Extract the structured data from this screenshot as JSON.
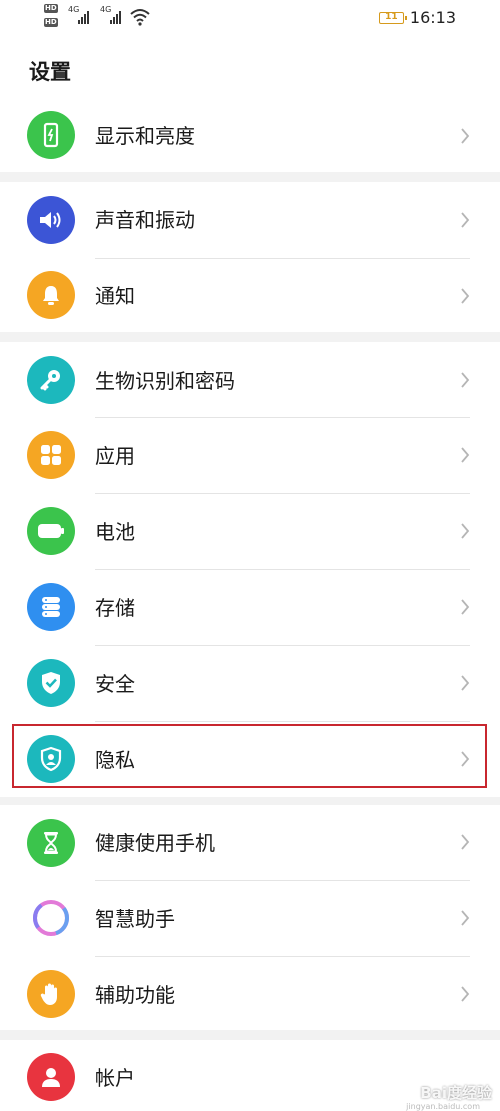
{
  "status_bar": {
    "hd1": "HD",
    "hd2": "HD",
    "net1": "4G",
    "net2": "4G",
    "battery_level": "11",
    "time": "16:13"
  },
  "header": {
    "title": "设置"
  },
  "items": [
    {
      "label": "显示和亮度",
      "icon": "display-brightness-icon",
      "color": "#3bc44c"
    },
    {
      "label": "声音和振动",
      "icon": "speaker-icon",
      "color": "#3c55d6"
    },
    {
      "label": "通知",
      "icon": "bell-icon",
      "color": "#f5a623"
    },
    {
      "label": "生物识别和密码",
      "icon": "key-icon",
      "color": "#1cb8bd"
    },
    {
      "label": "应用",
      "icon": "apps-grid-icon",
      "color": "#f5a623"
    },
    {
      "label": "电池",
      "icon": "battery-icon",
      "color": "#3bc44c"
    },
    {
      "label": "存储",
      "icon": "storage-icon",
      "color": "#2f8ff0"
    },
    {
      "label": "安全",
      "icon": "shield-check-icon",
      "color": "#1cb8bd"
    },
    {
      "label": "隐私",
      "icon": "privacy-shield-icon",
      "color": "#1cb8bd"
    },
    {
      "label": "健康使用手机",
      "icon": "hourglass-icon",
      "color": "#3bc44c"
    },
    {
      "label": "智慧助手",
      "icon": "assistant-ring-icon",
      "color": "#8a7cf0"
    },
    {
      "label": "辅助功能",
      "icon": "hand-icon",
      "color": "#f5a623"
    },
    {
      "label": "帐户",
      "icon": "user-icon",
      "color": "#e8343f"
    }
  ],
  "watermark": {
    "text": "Bai度经验",
    "sub": "jingyan.baidu.com"
  }
}
